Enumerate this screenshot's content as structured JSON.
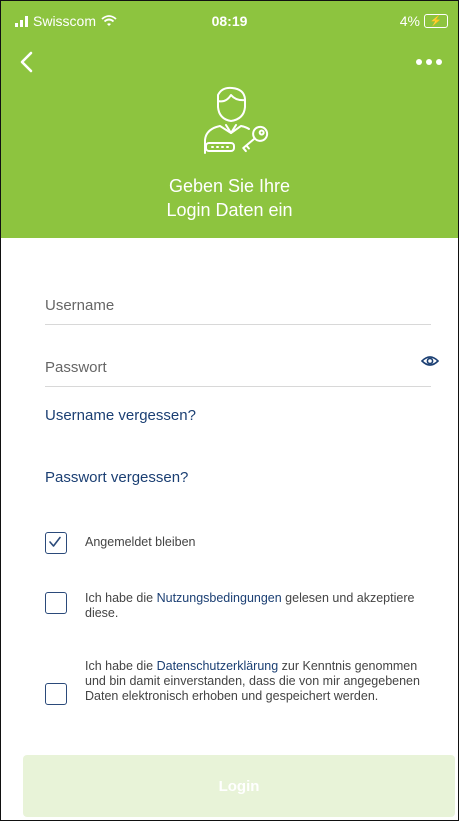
{
  "status_bar": {
    "carrier": "Swisscom",
    "time": "08:19",
    "battery": "4%"
  },
  "header": {
    "title_line1": "Geben Sie Ihre",
    "title_line2": "Login Daten ein"
  },
  "form": {
    "username_placeholder": "Username",
    "username_value": "",
    "password_placeholder": "Passwort",
    "password_value": ""
  },
  "links": {
    "forgot_username": "Username vergessen?",
    "forgot_password": "Passwort vergessen?"
  },
  "checkboxes": {
    "remember": {
      "label": "Angemeldet bleiben",
      "checked": true
    },
    "terms": {
      "before": "Ich habe die ",
      "link": "Nutzungsbedingungen",
      "after": " gelesen und akzeptiere diese.",
      "checked": false
    },
    "privacy": {
      "before": "Ich habe die ",
      "link": "Datenschutzerklärung",
      "after": " zur Kenntnis genommen und bin damit einverstanden, dass die von mir angegebenen Daten elektronisch erhoben und gespeichert werden.",
      "checked": false
    }
  },
  "login_button": "Login",
  "colors": {
    "header_green": "#8dc43f",
    "link_blue": "#1b3f73",
    "button_disabled": "#e8f3d8"
  },
  "icons": {
    "back": "chevron-left-icon",
    "more": "more-dots-icon",
    "avatar": "user-key-icon",
    "eye": "eye-icon",
    "check": "checkmark-icon"
  }
}
